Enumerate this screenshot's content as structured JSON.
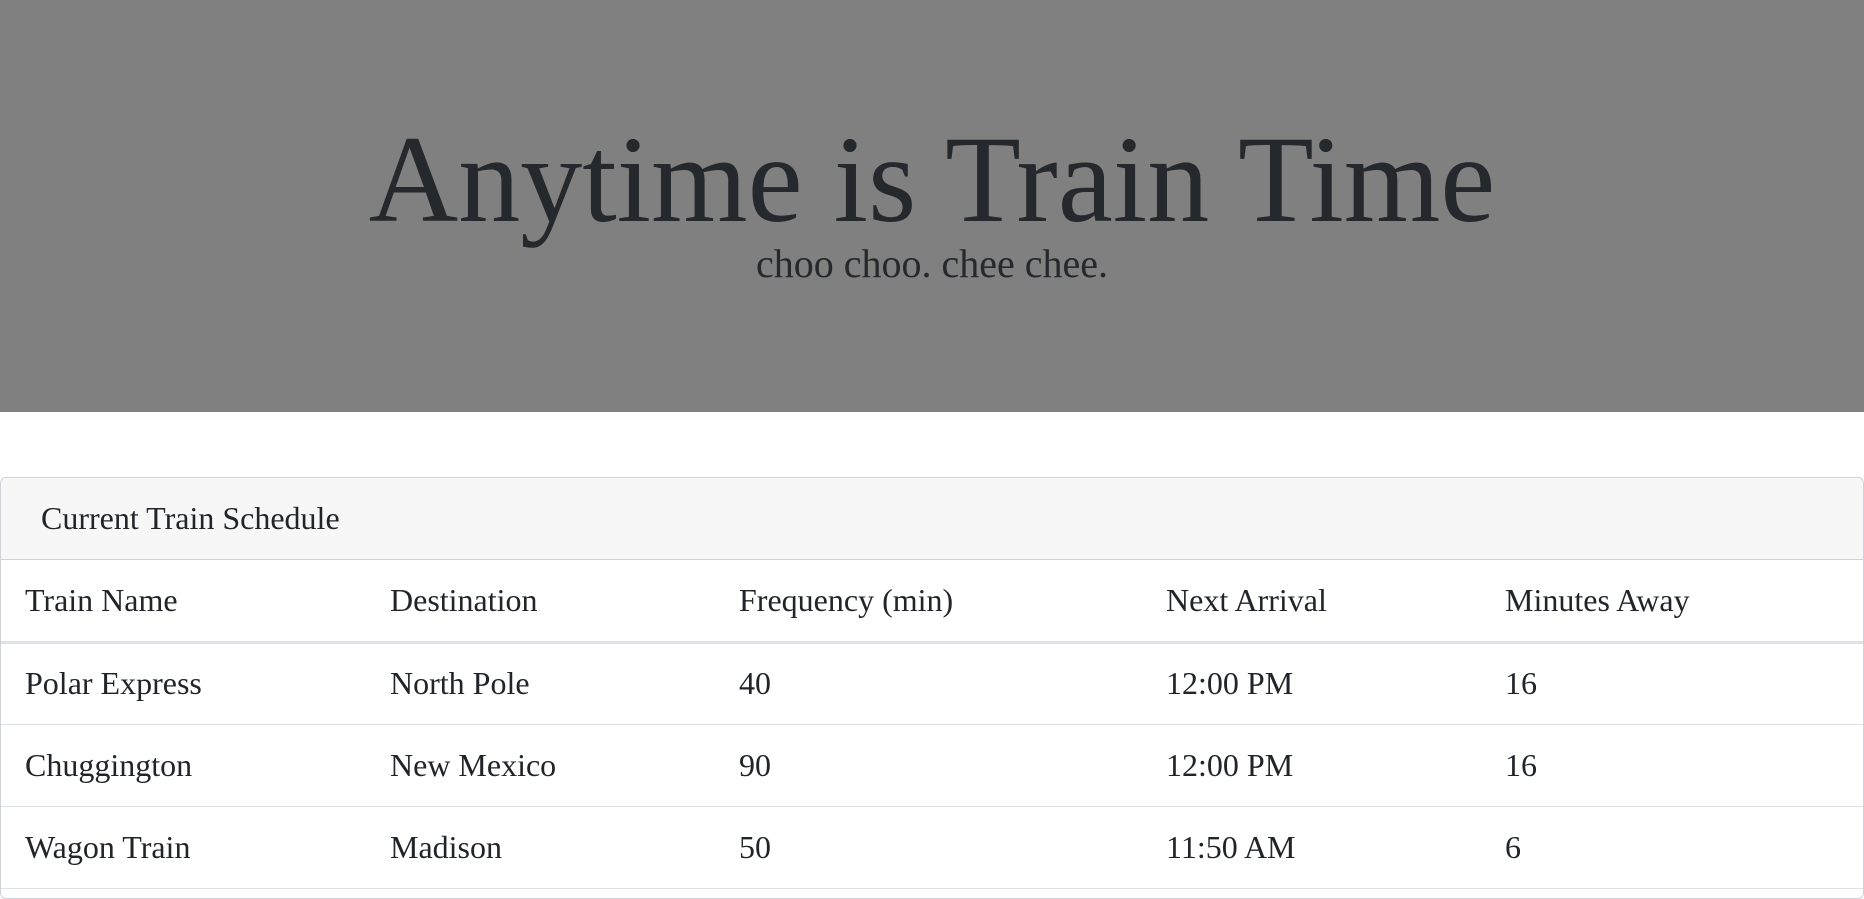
{
  "jumbotron": {
    "title": "Anytime is Train Time",
    "subtitle": "choo choo. chee chee.",
    "background_color": "#808080"
  },
  "schedule": {
    "header": "Current Train Schedule",
    "columns": [
      "Train Name",
      "Destination",
      "Frequency (min)",
      "Next Arrival",
      "Minutes Away"
    ],
    "rows": [
      [
        "Polar Express",
        "North Pole",
        "40",
        "12:00 PM",
        "16"
      ],
      [
        "Chuggington",
        "New Mexico",
        "90",
        "12:00 PM",
        "16"
      ],
      [
        "Wagon Train",
        "Madison",
        "50",
        "11:50 AM",
        "6"
      ]
    ]
  }
}
